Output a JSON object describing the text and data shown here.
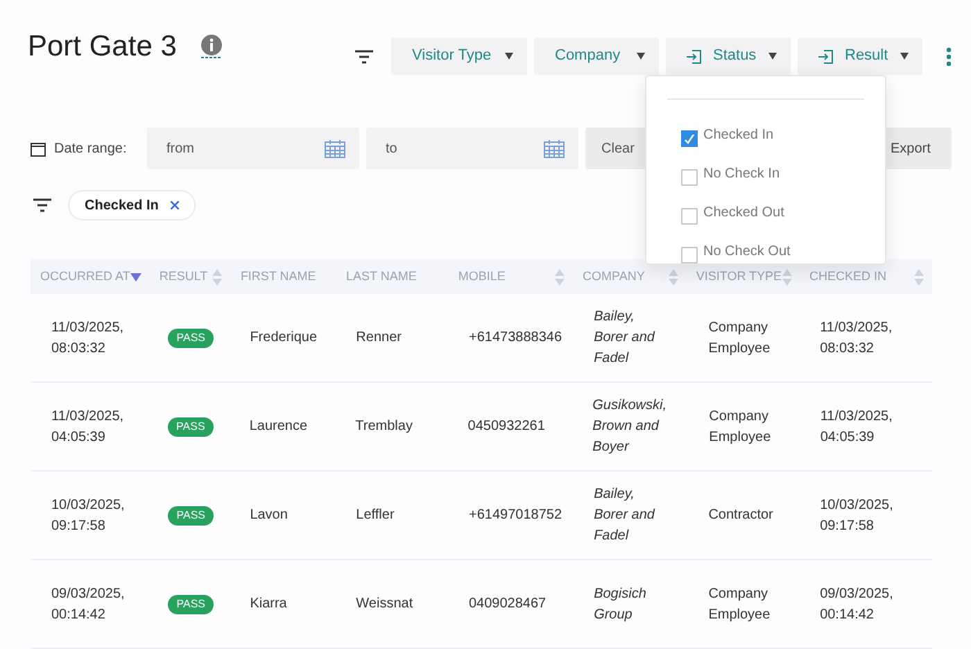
{
  "title": "Port Gate 3",
  "filters": [
    {
      "label": "Visitor Type",
      "kind": "plain"
    },
    {
      "label": "Company",
      "kind": "plain"
    },
    {
      "label": "Status",
      "kind": "entry"
    },
    {
      "label": "Result",
      "kind": "entry"
    }
  ],
  "date_range": {
    "label": "Date range:",
    "from_placeholder": "from",
    "to_placeholder": "to",
    "clear": "Clear",
    "export": "Export"
  },
  "active_filters": [
    {
      "label": "Checked In"
    }
  ],
  "status_menu": [
    {
      "label": "Checked In",
      "checked": true
    },
    {
      "label": "No Check In",
      "checked": false
    },
    {
      "label": "Checked Out",
      "checked": false
    },
    {
      "label": "No Check Out",
      "checked": false
    }
  ],
  "table": {
    "columns": [
      {
        "label": "OCCURRED AT",
        "kind": "sorted"
      },
      {
        "label": "RESULT",
        "kind": "sortable"
      },
      {
        "label": "FIRST NAME",
        "kind": "plain"
      },
      {
        "label": "LAST NAME",
        "kind": "plain"
      },
      {
        "label": "MOBILE",
        "kind": "sortable"
      },
      {
        "label": "COMPANY",
        "kind": "sortable"
      },
      {
        "label": "VISITOR TYPE",
        "kind": "sortable"
      },
      {
        "label": "CHECKED IN",
        "kind": "sortable"
      }
    ],
    "rows": [
      [
        "11/03/2025, 08:03:32",
        "PASS",
        "Frederique",
        "Renner",
        "+61473888346",
        "Bailey, Borer and Fadel",
        "Company Employee",
        "11/03/2025, 08:03:32"
      ],
      [
        "11/03/2025, 04:05:39",
        "PASS",
        "Laurence",
        "Tremblay",
        "0450932261",
        "Gusikowski, Brown and Boyer",
        "Company Employee",
        "11/03/2025, 04:05:39"
      ],
      [
        "10/03/2025, 09:17:58",
        "PASS",
        "Lavon",
        "Leffler",
        "+61497018752",
        "Bailey, Borer and Fadel",
        "Contractor",
        "10/03/2025, 09:17:58"
      ],
      [
        "09/03/2025, 00:14:42",
        "PASS",
        "Kiarra",
        "Weissnat",
        "0409028467",
        "Bogisich Group",
        "Company Employee",
        "09/03/2025, 00:14:42"
      ]
    ]
  }
}
